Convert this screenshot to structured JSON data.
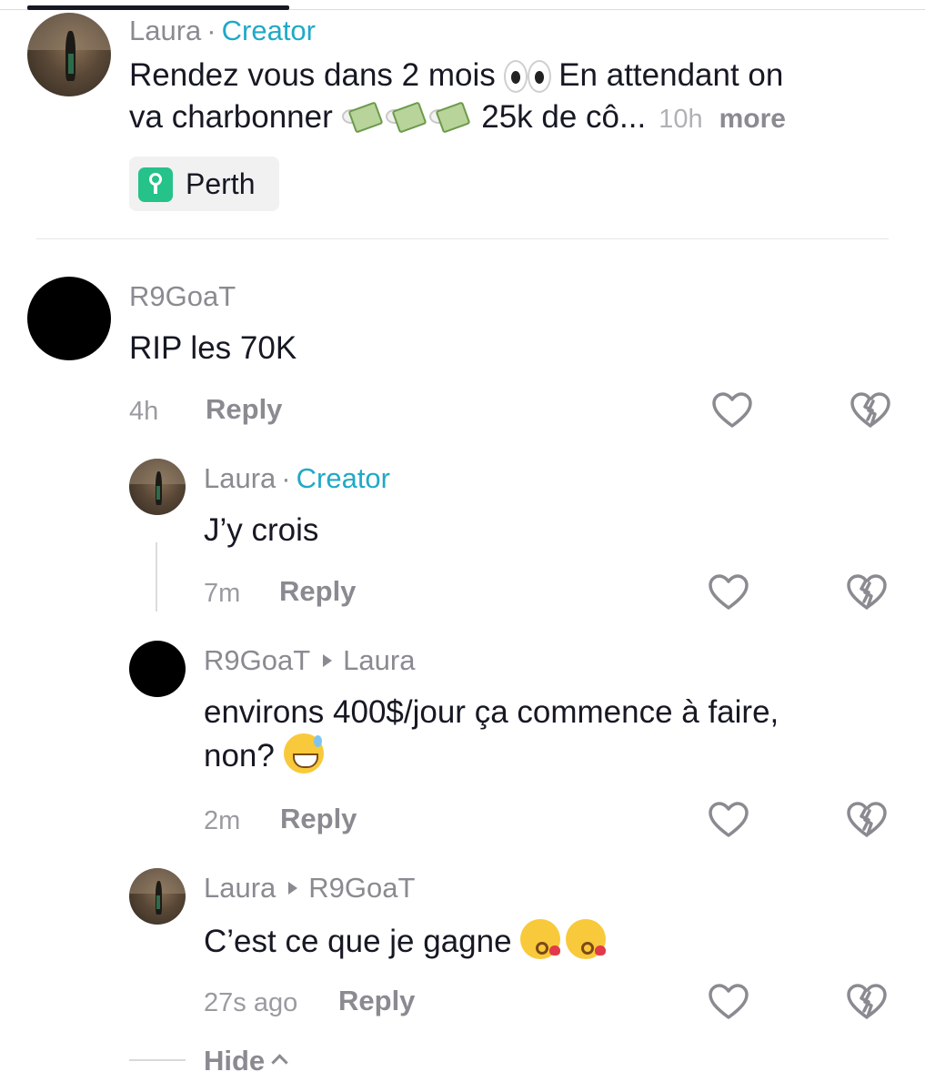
{
  "comments": [
    {
      "user": "Laura",
      "badge": "Creator",
      "text_part1": "Rendez vous dans 2 mois",
      "text_part2": "En attendant on",
      "text_line2": "va charbonner",
      "text_part3": "25k de cô...",
      "time": "10h",
      "more": "more",
      "location": "Perth"
    },
    {
      "user": "R9GoaT",
      "text": "RIP les 70K",
      "time": "4h",
      "reply": "Reply"
    }
  ],
  "replies": [
    {
      "user": "Laura",
      "badge": "Creator",
      "text": "J’y crois",
      "time": "7m",
      "reply": "Reply"
    },
    {
      "user": "R9GoaT",
      "to": "Laura",
      "text_line1": "environs 400$/jour ça commence à faire,",
      "text_line2": "non?",
      "time": "2m",
      "reply": "Reply"
    },
    {
      "user": "Laura",
      "to": "R9GoaT",
      "text": "C’est ce que je gagne",
      "time": "27s ago",
      "reply": "Reply"
    }
  ],
  "hide_label": "Hide",
  "icons": [
    "heart-icon",
    "dislike-icon",
    "location-pin-icon",
    "chevron-up-icon"
  ],
  "colors": {
    "creator_badge": "#20a9c7",
    "location_pin": "#25c28a",
    "text": "#161823",
    "muted": "#8a8b91"
  }
}
